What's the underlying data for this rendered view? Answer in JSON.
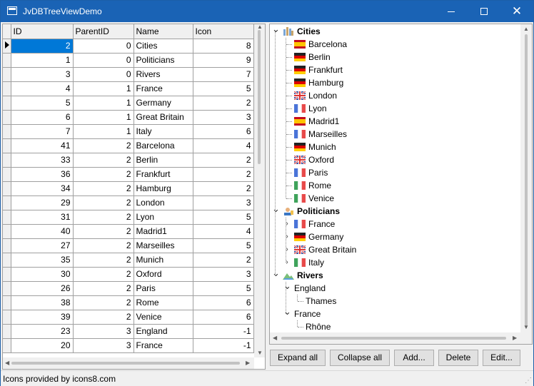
{
  "window": {
    "title": "JvDBTreeViewDemo"
  },
  "grid": {
    "columns": [
      "ID",
      "ParentID",
      "Name",
      "Icon"
    ],
    "rows": [
      [
        "2",
        "0",
        "Cities",
        "8"
      ],
      [
        "1",
        "0",
        "Politicians",
        "9"
      ],
      [
        "3",
        "0",
        "Rivers",
        "7"
      ],
      [
        "4",
        "1",
        "France",
        "5"
      ],
      [
        "5",
        "1",
        "Germany",
        "2"
      ],
      [
        "6",
        "1",
        "Great Britain",
        "3"
      ],
      [
        "7",
        "1",
        "Italy",
        "6"
      ],
      [
        "41",
        "2",
        "Barcelona",
        "4"
      ],
      [
        "33",
        "2",
        "Berlin",
        "2"
      ],
      [
        "36",
        "2",
        "Frankfurt",
        "2"
      ],
      [
        "34",
        "2",
        "Hamburg",
        "2"
      ],
      [
        "29",
        "2",
        "London",
        "3"
      ],
      [
        "31",
        "2",
        "Lyon",
        "5"
      ],
      [
        "40",
        "2",
        "Madrid1",
        "4"
      ],
      [
        "27",
        "2",
        "Marseilles",
        "5"
      ],
      [
        "35",
        "2",
        "Munich",
        "2"
      ],
      [
        "30",
        "2",
        "Oxford",
        "3"
      ],
      [
        "26",
        "2",
        "Paris",
        "5"
      ],
      [
        "38",
        "2",
        "Rome",
        "6"
      ],
      [
        "39",
        "2",
        "Venice",
        "6"
      ],
      [
        "23",
        "3",
        "England",
        "-1"
      ],
      [
        "20",
        "3",
        "France",
        "-1"
      ]
    ]
  },
  "tree": {
    "nodes": [
      {
        "label": "Cities",
        "level": 0,
        "bold": true,
        "twisty": "open",
        "icon": "cities-icon"
      },
      {
        "label": "Barcelona",
        "level": 1,
        "icon": "flag-es"
      },
      {
        "label": "Berlin",
        "level": 1,
        "icon": "flag-de"
      },
      {
        "label": "Frankfurt",
        "level": 1,
        "icon": "flag-de"
      },
      {
        "label": "Hamburg",
        "level": 1,
        "icon": "flag-de"
      },
      {
        "label": "London",
        "level": 1,
        "icon": "flag-gb"
      },
      {
        "label": "Lyon",
        "level": 1,
        "icon": "flag-fr"
      },
      {
        "label": "Madrid1",
        "level": 1,
        "icon": "flag-es"
      },
      {
        "label": "Marseilles",
        "level": 1,
        "icon": "flag-fr"
      },
      {
        "label": "Munich",
        "level": 1,
        "icon": "flag-de"
      },
      {
        "label": "Oxford",
        "level": 1,
        "icon": "flag-gb"
      },
      {
        "label": "Paris",
        "level": 1,
        "icon": "flag-fr"
      },
      {
        "label": "Rome",
        "level": 1,
        "icon": "flag-it"
      },
      {
        "label": "Venice",
        "level": 1,
        "icon": "flag-it"
      },
      {
        "label": "Politicians",
        "level": 0,
        "bold": true,
        "twisty": "open",
        "icon": "politicians-icon"
      },
      {
        "label": "France",
        "level": 1,
        "twisty": "closed",
        "icon": "flag-fr"
      },
      {
        "label": "Germany",
        "level": 1,
        "twisty": "closed",
        "icon": "flag-de"
      },
      {
        "label": "Great Britain",
        "level": 1,
        "twisty": "closed",
        "icon": "flag-gb"
      },
      {
        "label": "Italy",
        "level": 1,
        "twisty": "closed",
        "icon": "flag-it"
      },
      {
        "label": "Rivers",
        "level": 0,
        "bold": true,
        "twisty": "open",
        "icon": "rivers-icon"
      },
      {
        "label": "England",
        "level": 1,
        "twisty": "open",
        "icon": ""
      },
      {
        "label": "Thames",
        "level": 2,
        "icon": ""
      },
      {
        "label": "France",
        "level": 1,
        "twisty": "open",
        "icon": ""
      },
      {
        "label": "Rhône",
        "level": 2,
        "icon": ""
      }
    ]
  },
  "buttons": {
    "expand_all": "Expand all",
    "collapse_all": "Collapse all",
    "add": "Add...",
    "delete": "Delete",
    "edit": "Edit..."
  },
  "status": {
    "text": "Icons provided by icons8.com"
  },
  "colors": {
    "titlebar": "#1a63b5",
    "selection": "#0078d7"
  }
}
